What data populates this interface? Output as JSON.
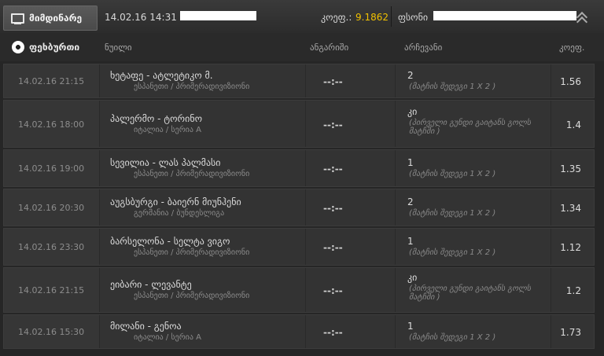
{
  "topbar": {
    "tab_label": "მიმდინარე",
    "datetime": "14.02.16 14:31",
    "coef_label": "კოეფ.:",
    "coef_value": "9.1862",
    "sum_label": "ფსონი"
  },
  "header": {
    "category": "ფეხბურთი",
    "col_event": "ნუილი",
    "col_score": "ანგარიში",
    "col_choice": "არჩევანი",
    "col_odds": "კოეფ."
  },
  "rows": [
    {
      "date": "14.02.16 21:15",
      "teams": "ხეტაფე - ატლეტიკო მ.",
      "league": "ესპანეთი / პრიმერადივიზიონი",
      "score": "--:--",
      "pick": "2",
      "pick_desc": "(მატჩის შედეგი 1 X 2 )",
      "odd": "1.56"
    },
    {
      "date": "14.02.16 18:00",
      "teams": "პალერმო - ტორინო",
      "league": "იტალია / სერია A",
      "score": "--:--",
      "pick": "კი",
      "pick_desc": "(პირველი გუნდი გაიტანს გოლს მატჩში )",
      "odd": "1.4"
    },
    {
      "date": "14.02.16 19:00",
      "teams": "სევილია - ლას პალმასი",
      "league": "ესპანეთი / პრიმერადივიზიონი",
      "score": "--:--",
      "pick": "1",
      "pick_desc": "(მატჩის შედეგი 1 X 2 )",
      "odd": "1.35"
    },
    {
      "date": "14.02.16 20:30",
      "teams": "აუგსბურგი - ბაიერნ მიუნჰენი",
      "league": "გერმანია / ბუნდესლიგა",
      "score": "--:--",
      "pick": "2",
      "pick_desc": "(მატჩის შედეგი 1 X 2 )",
      "odd": "1.34"
    },
    {
      "date": "14.02.16 23:30",
      "teams": "ბარსელონა - სელტა ვიგო",
      "league": "ესპანეთი / პრიმერადივიზიონი",
      "score": "--:--",
      "pick": "1",
      "pick_desc": "(მატჩის შედეგი 1 X 2 )",
      "odd": "1.12"
    },
    {
      "date": "14.02.16 21:15",
      "teams": "ეიბარი - ლევანტე",
      "league": "ესპანეთი / პრიმერადივიზიონი",
      "score": "--:--",
      "pick": "კი",
      "pick_desc": "(პირველი გუნდი გაიტანს გოლს მატჩში )",
      "odd": "1.2"
    },
    {
      "date": "14.02.16 15:30",
      "teams": "მილანი - გენოა",
      "league": "იტალია / სერია A",
      "score": "--:--",
      "pick": "1",
      "pick_desc": "(მატჩის შედეგი 1 X 2 )",
      "odd": "1.73"
    }
  ]
}
